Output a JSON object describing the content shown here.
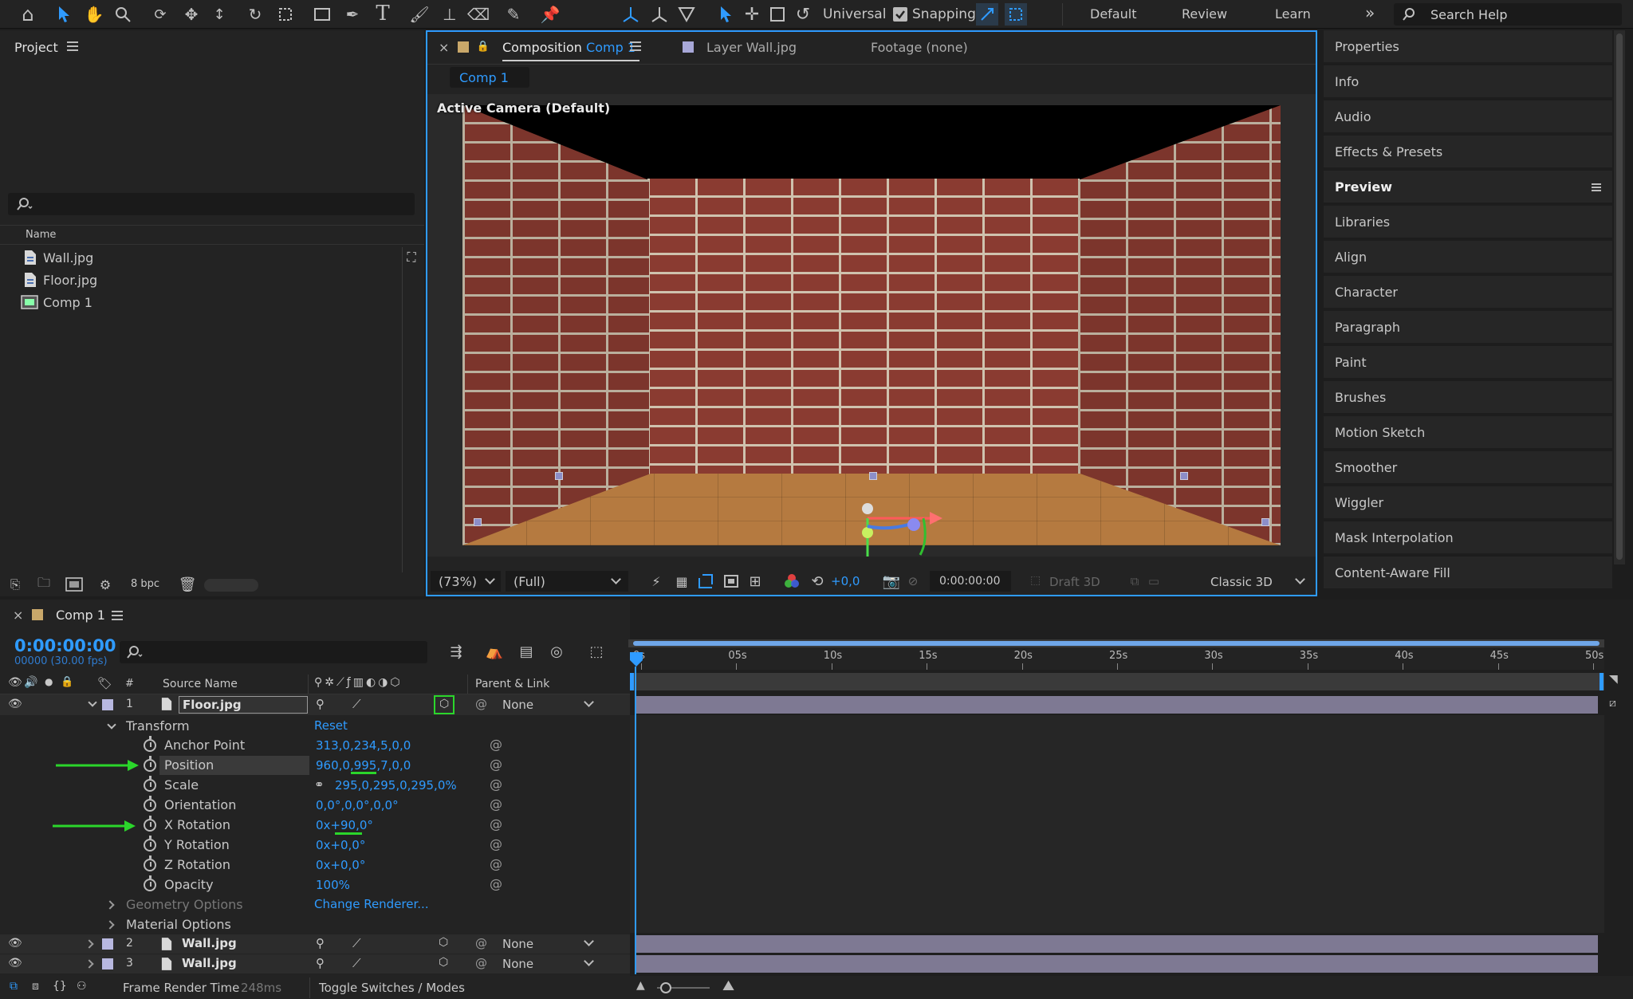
{
  "toolbar": {
    "universal_label": "Universal",
    "snapping_label": "Snapping",
    "workspaces": [
      "Default",
      "Review",
      "Learn"
    ],
    "overflow": "»",
    "search_placeholder": "Search Help"
  },
  "project": {
    "title": "Project",
    "column_name": "Name",
    "items": [
      {
        "name": "Wall.jpg",
        "icon": "file-icon"
      },
      {
        "name": "Floor.jpg",
        "icon": "file-icon"
      },
      {
        "name": "Comp 1",
        "icon": "composition-icon"
      }
    ],
    "bpc": "8 bpc"
  },
  "viewer": {
    "tab_composition_prefix": "Composition",
    "tab_composition_name": "Comp 1",
    "tab_layer": "Layer Wall.jpg",
    "tab_footage": "Footage (none)",
    "comp_tab": "Comp 1",
    "camera_label": "Active Camera (Default)",
    "zoom": "(73%)",
    "resolution": "(Full)",
    "exposure": "+0,0",
    "timecode": "0:00:00:00",
    "draft3d": "Draft 3D",
    "renderer": "Classic 3D"
  },
  "right_panel": {
    "items": [
      "Properties",
      "Info",
      "Audio",
      "Effects & Presets",
      "Preview",
      "Libraries",
      "Align",
      "Character",
      "Paragraph",
      "Paint",
      "Brushes",
      "Motion Sketch",
      "Smoother",
      "Wiggler",
      "Mask Interpolation",
      "Content-Aware Fill"
    ]
  },
  "timeline": {
    "comp_name": "Comp 1",
    "timecode": "0:00:00:00",
    "frame_info": "00000 (30.00 fps)",
    "col_hash": "#",
    "col_source": "Source Name",
    "col_parent": "Parent & Link",
    "ruler": [
      "0s",
      "05s",
      "10s",
      "15s",
      "20s",
      "25s",
      "30s",
      "35s",
      "40s",
      "45s",
      "50s"
    ],
    "layer1": {
      "num": "1",
      "name": "Floor.jpg",
      "parent": "None"
    },
    "transform_label": "Transform",
    "reset_label": "Reset",
    "props": [
      {
        "name": "Anchor Point",
        "value": "313,0,234,5,0,0"
      },
      {
        "name": "Position",
        "value": "960,0,995,7,0,0"
      },
      {
        "name": "Scale",
        "value": "295,0,295,0,295,0%"
      },
      {
        "name": "Orientation",
        "value": "0,0°,0,0°,0,0°"
      },
      {
        "name": "X Rotation",
        "value": "0x+90,0°"
      },
      {
        "name": "Y Rotation",
        "value": "0x+0,0°"
      },
      {
        "name": "Z Rotation",
        "value": "0x+0,0°"
      },
      {
        "name": "Opacity",
        "value": "100%"
      }
    ],
    "geometry_label": "Geometry Options",
    "change_renderer": "Change Renderer...",
    "material_label": "Material Options",
    "layer2": {
      "num": "2",
      "name": "Wall.jpg",
      "parent": "None"
    },
    "layer3": {
      "num": "3",
      "name": "Wall.jpg",
      "parent": "None"
    },
    "frame_render_label": "Frame Render Time",
    "frame_render_value": "248ms",
    "toggle_label": "Toggle Switches / Modes"
  },
  "colors": {
    "accent": "#2f9bff",
    "highlight": "#2bd62b",
    "layer_bar": "#8f8aa8"
  }
}
